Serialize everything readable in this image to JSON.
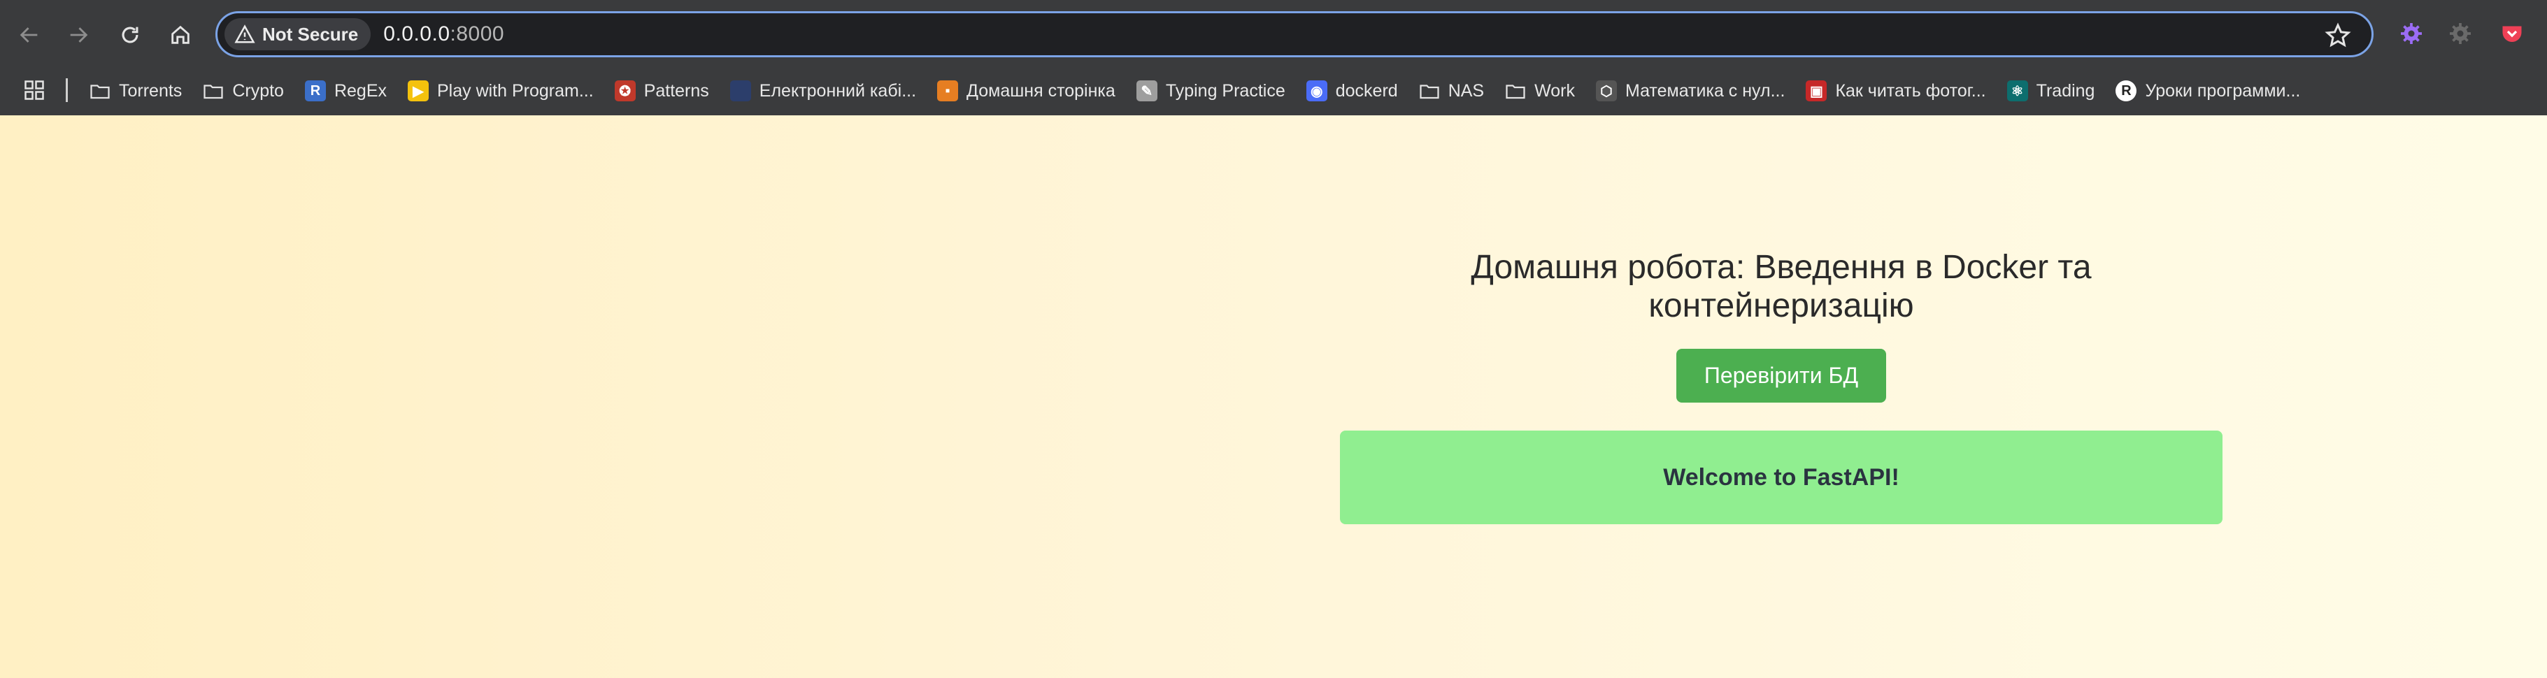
{
  "browser": {
    "security_chip": "Not Secure",
    "url_host": "0.0.0.0",
    "url_port": ":8000"
  },
  "bookmarks": [
    {
      "label": "Torrents",
      "icon": "folder-icon"
    },
    {
      "label": "Crypto",
      "icon": "folder-icon"
    },
    {
      "label": "RegEx",
      "icon": "regex-favicon",
      "glyph": "R",
      "color": "#3b6fc9"
    },
    {
      "label": "Play with Program...",
      "icon": "play-favicon",
      "glyph": "▶",
      "color": "#f4c20d"
    },
    {
      "label": "Patterns",
      "icon": "patterns-favicon",
      "glyph": "✪",
      "color": "#c0392b"
    },
    {
      "label": "Електронний кабі...",
      "icon": "cabinet-favicon",
      "glyph": "",
      "color": "#2c3e6b"
    },
    {
      "label": "Домашня сторінка",
      "icon": "home-favicon",
      "glyph": "▪",
      "color": "#e67e22"
    },
    {
      "label": "Typing Practice",
      "icon": "typing-favicon",
      "glyph": "✎",
      "color": "#9e9e9e"
    },
    {
      "label": "dockerd",
      "icon": "docker-favicon",
      "glyph": "◉",
      "color": "#4a6cf7"
    },
    {
      "label": "NAS",
      "icon": "folder-icon"
    },
    {
      "label": "Work",
      "icon": "folder-icon"
    },
    {
      "label": "Математика с нул...",
      "icon": "math-favicon",
      "glyph": "⬡",
      "color": "#555555"
    },
    {
      "label": "Как читать фотог...",
      "icon": "photo-favicon",
      "glyph": "▣",
      "color": "#c62828"
    },
    {
      "label": "Trading",
      "icon": "trading-favicon",
      "glyph": "⚛",
      "color": "#0d6e6e"
    },
    {
      "label": "Уроки программи...",
      "icon": "lessons-favicon",
      "glyph": "R",
      "color": "#ffffff"
    }
  ],
  "main": {
    "title": "Домашня робота: Введення в Docker та контейнеризацію",
    "check_db_button": "Перевірити БД",
    "message": "Welcome to FastAPI!"
  },
  "colors": {
    "button": "#4caf50",
    "message_bg": "#90ee90",
    "focus_ring": "#7ba3e6"
  }
}
